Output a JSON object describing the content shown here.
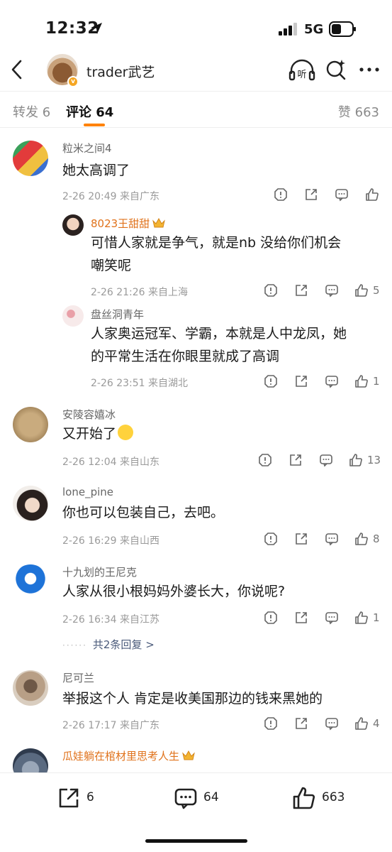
{
  "status_bar": {
    "time": "12:32",
    "network": "5G"
  },
  "header": {
    "title": "trader武艺"
  },
  "tabs": {
    "repost": "转发 6",
    "comments": "评论 64",
    "likes": "赞 663"
  },
  "comments": [
    {
      "name": "粒米之间4",
      "text": "她太高调了",
      "meta": "2-26 20:49 来自广东",
      "like_count": "",
      "replies": [
        {
          "name": "8023王甜甜",
          "text_lines": [
            "可惜人家就是争气，就是nb 没给你们机会",
            "嘲笑呢"
          ],
          "meta": "2-26 21:26 来自上海",
          "like_count": "5"
        },
        {
          "name": "盘丝洞青年",
          "text_lines": [
            "人家奥运冠军、学霸，本就是人中龙凤，她",
            "的平常生活在你眼里就成了高调"
          ],
          "meta": "2-26 23:51 来自湖北",
          "like_count": "1"
        }
      ]
    },
    {
      "name": "安陵容嬉冰",
      "text": "又开始了",
      "meta": "2-26 12:04 来自山东",
      "like_count": "13"
    },
    {
      "name": "lone_pine",
      "text": "你也可以包装自己，去吧。",
      "meta": "2-26 16:29 来自山西",
      "like_count": "8"
    },
    {
      "name": "十九划的王尼克",
      "text": "人家从很小根妈妈外婆长大，你说呢?",
      "meta": "2-26 16:34 来自江苏",
      "like_count": "1",
      "more_replies": "共2条回复 >"
    },
    {
      "name": "尼可兰",
      "text": "举报这个人 肯定是收美国那边的钱来黑她的",
      "meta": "2-26 17:17 来自广东",
      "like_count": "4"
    },
    {
      "name": "瓜娃躺在棺材里思考人生"
    }
  ],
  "bottom_bar": {
    "repost_count": "6",
    "comment_count": "64",
    "like_count": "663"
  },
  "colors": {
    "accent": "#ff8200",
    "reply_name": "#e0721b",
    "meta": "#9a9a9a"
  },
  "icons": [
    "back-arrow-icon",
    "headphone-listen-icon",
    "search-sparkle-icon",
    "more-dots-icon",
    "report-icon",
    "share-icon",
    "comment-icon",
    "like-icon",
    "crown-icon"
  ]
}
